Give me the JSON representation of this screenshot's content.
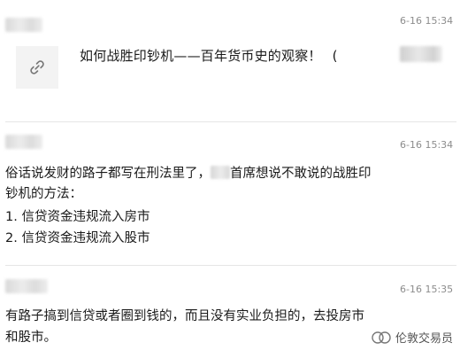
{
  "messages": [
    {
      "time": "6-16 15:34",
      "share_title": "如何战胜印钞机——百年货币史的观察！",
      "share_title_tail": "(",
      "icon": "link-icon"
    },
    {
      "time": "6-16 15:34",
      "line1_a": "俗话说发财的路子都写在刑法里了，",
      "line1_b": "首席想说不敢说的战胜印",
      "line2": "钞机的方法：",
      "line3": "1. 信贷资金违规流入房市",
      "line4": "2. 信贷资金违规流入股市"
    },
    {
      "time": "6-16 15:35",
      "line1": "有路子搞到信贷或者圈到钱的，而且没有实业负担的，去投房市",
      "line2": "和股市。"
    }
  ],
  "watermark": {
    "text": "伦敦交易员",
    "icon": "wechat-official-account-icon"
  }
}
